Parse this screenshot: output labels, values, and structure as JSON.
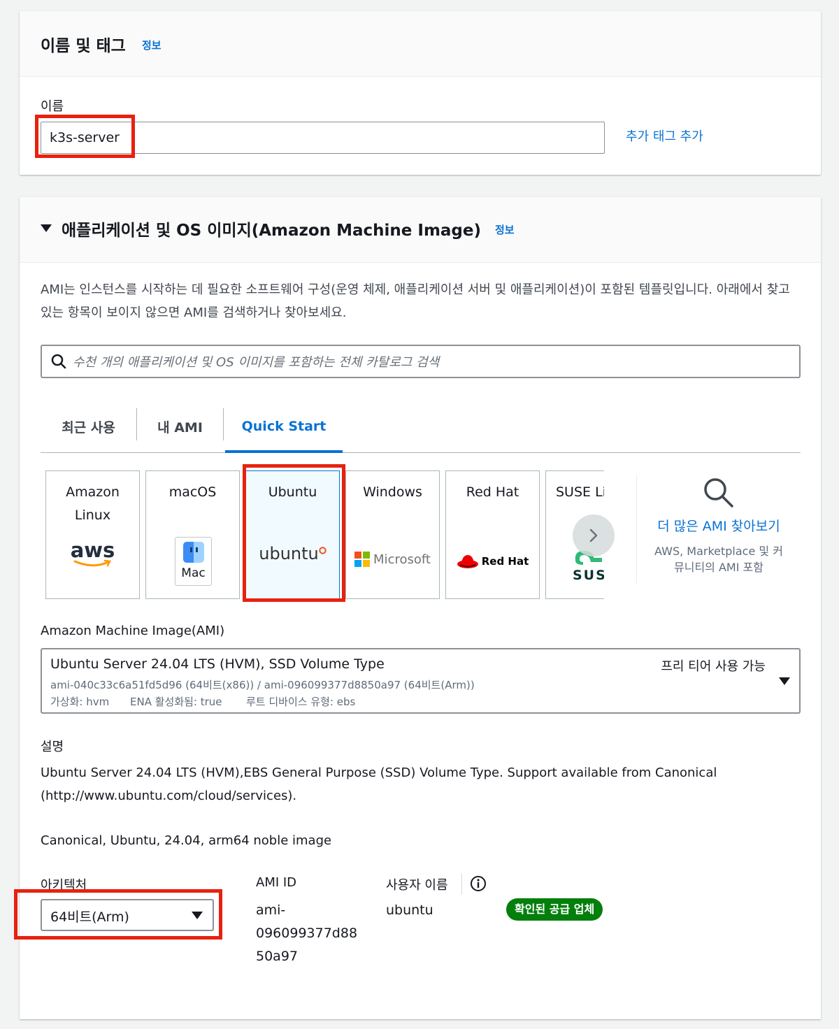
{
  "name_section": {
    "title": "이름 및 태그",
    "info": "정보",
    "name_label": "이름",
    "name_value": "k3s-server",
    "add_tag": "추가 태그 추가"
  },
  "ami_section": {
    "title": "애플리케이션 및 OS 이미지(Amazon Machine Image)",
    "info": "정보",
    "description": "AMI는 인스턴스를 시작하는 데 필요한 소프트웨어 구성(운영 체제, 애플리케이션 서버 및 애플리케이션)이 포함된 템플릿입니다. 아래에서 찾고 있는 항목이 보이지 않으면 AMI를 검색하거나 찾아보세요.",
    "search_placeholder": "수천 개의 애플리케이션 및 OS 이미지를 포함하는 전체 카탈로그 검색",
    "tabs": [
      {
        "label": "최근 사용"
      },
      {
        "label": "내 AMI"
      },
      {
        "label": "Quick Start"
      }
    ],
    "os_cards": [
      {
        "name1": "Amazon",
        "name2": "Linux",
        "logo": "aws"
      },
      {
        "name1": "macOS",
        "logo": "Mac"
      },
      {
        "name1": "Ubuntu",
        "logo": "ubuntu"
      },
      {
        "name1": "Windows",
        "logo": "Microsoft"
      },
      {
        "name1": "Red Hat",
        "logo": "Red Hat"
      },
      {
        "name1": "SUSE Li",
        "logo": "SUS"
      }
    ],
    "more_ami": {
      "title": "더 많은 AMI 찾아보기",
      "line1": "AWS, Marketplace 및 커",
      "line2": "뮤니티의 AMI 포함"
    },
    "ami_label": "Amazon Machine Image(AMI)",
    "ami_selected": {
      "title": "Ubuntu Server 24.04 LTS (HVM), SSD Volume Type",
      "ids": "ami-040c33c6a51fd5d96 (64비트(x86)) / ami-096099377d8850a97 (64비트(Arm))",
      "virt": "가상화: hvm",
      "ena": "ENA 활성화됨: true",
      "root": "루트 디바이스 유형: ebs",
      "free_tier": "프리 티어 사용 가능"
    },
    "desc_label": "설명",
    "desc_line1": "Ubuntu Server 24.04 LTS (HVM),EBS General Purpose (SSD) Volume Type. Support available from Canonical",
    "desc_line2": "(http://www.ubuntu.com/cloud/services).",
    "image_line": "Canonical, Ubuntu, 24.04, arm64 noble image",
    "arch_label": "아키텍처",
    "arch_value": "64비트(Arm)",
    "ami_id_label": "AMI ID",
    "ami_id_1": "ami-",
    "ami_id_2": "096099377d88",
    "ami_id_3": "50a97",
    "user_label": "사용자 이름",
    "user_value": "ubuntu",
    "verified": "확인된 공급 업체"
  },
  "colors": {
    "link": "#0972d3",
    "highlight": "#e8210f",
    "badge": "#037f0c"
  }
}
